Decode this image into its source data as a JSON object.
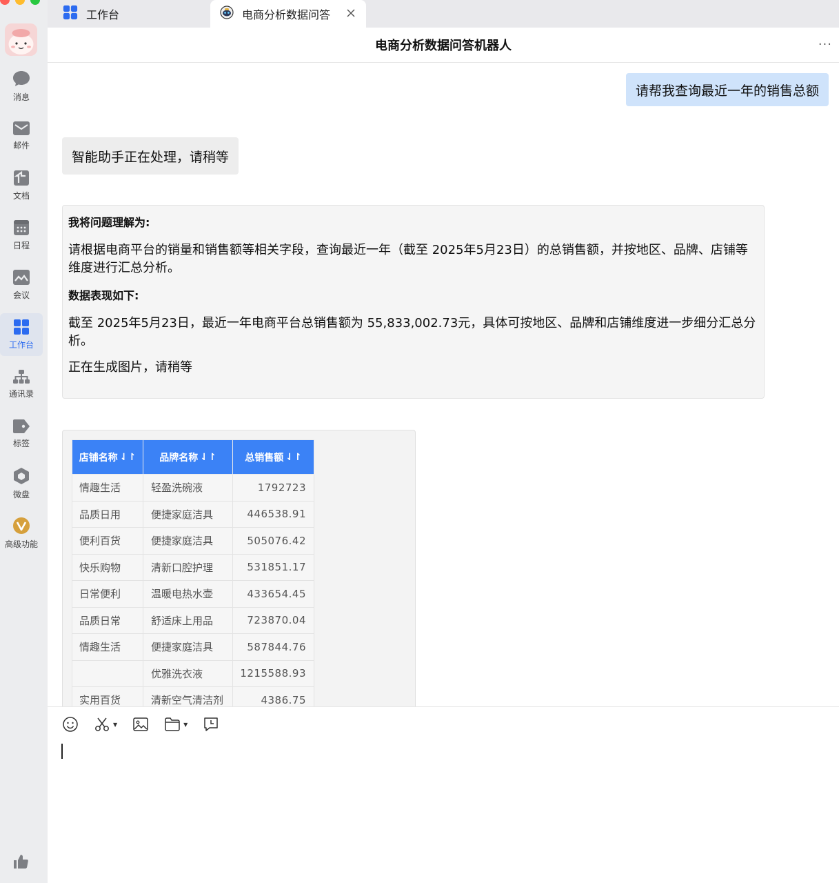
{
  "window": {
    "traffic_colors": [
      "#ff5f57",
      "#febc2e",
      "#28c840"
    ]
  },
  "sidebar": {
    "items": [
      {
        "label": "消息",
        "icon": "chat-bubble-icon",
        "active": false
      },
      {
        "label": "邮件",
        "icon": "mail-icon",
        "active": false
      },
      {
        "label": "文档",
        "icon": "document-icon",
        "active": false
      },
      {
        "label": "日程",
        "icon": "calendar-icon",
        "active": false
      },
      {
        "label": "会议",
        "icon": "meeting-icon",
        "active": false
      },
      {
        "label": "工作台",
        "icon": "workbench-grid-icon",
        "active": true
      },
      {
        "label": "通讯录",
        "icon": "org-chart-icon",
        "active": false
      },
      {
        "label": "标签",
        "icon": "tag-icon",
        "active": false
      },
      {
        "label": "微盘",
        "icon": "cloud-drive-icon",
        "active": false
      },
      {
        "label": "高级功能",
        "icon": "premium-v-icon",
        "active": false
      }
    ],
    "bottom_icon": "thumbs-up-icon"
  },
  "tabs": [
    {
      "label": "工作台",
      "icon": "workbench-grid-icon",
      "active": false
    },
    {
      "label": "电商分析数据问答",
      "icon": "bot-avatar-icon",
      "active": true
    }
  ],
  "chat": {
    "title": "电商分析数据问答机器人",
    "more_label": "···",
    "user_message": "请帮我查询最近一年的销售总额",
    "bot_status": "智能助手正在处理，请稍等",
    "answer": {
      "heading1": "我将问题理解为:",
      "paragraph1": "请根据电商平台的销量和销售额等相关字段，查询最近一年（截至 2025年5月23日）的总销售额，并按地区、品牌、店铺等维度进行汇总分析。",
      "heading2": "数据表现如下:",
      "paragraph2": "截至 2025年5月23日，最近一年电商平台总销售额为 55,833,002.73元，具体可按地区、品牌和店铺维度进一步细分汇总分析。",
      "paragraph3": "正在生成图片，请稍等"
    },
    "table": {
      "headers": [
        "店铺名称",
        "品牌名称",
        "总销售额"
      ],
      "sort_icon": "sort-arrows-icon",
      "header_color": "#3b82f6",
      "rows": [
        [
          "情趣生活",
          "轻盈洗碗液",
          "1792723"
        ],
        [
          "品质日用",
          "便捷家庭洁具",
          "446538.91"
        ],
        [
          "便利百货",
          "便捷家庭洁具",
          "505076.42"
        ],
        [
          "快乐购物",
          "清新口腔护理",
          "531851.17"
        ],
        [
          "日常便利",
          "温暖电热水壶",
          "433654.45"
        ],
        [
          "品质日常",
          "舒适床上用品",
          "723870.04"
        ],
        [
          "情趣生活",
          "便捷家庭洁具",
          "587844.76"
        ],
        [
          "",
          "优雅洗衣液",
          "1215588.93"
        ],
        [
          "实用百货",
          "清新空气清洁剂",
          "4386.75"
        ]
      ]
    }
  },
  "composer": {
    "tools": [
      "emoji-icon",
      "scissors-icon",
      "image-icon",
      "folder-icon",
      "chat-history-icon"
    ],
    "input_value": ""
  },
  "colors": {
    "accent": "#2c6bf0",
    "user_bubble": "#cfe3fb",
    "bot_bubble": "#ededed"
  }
}
